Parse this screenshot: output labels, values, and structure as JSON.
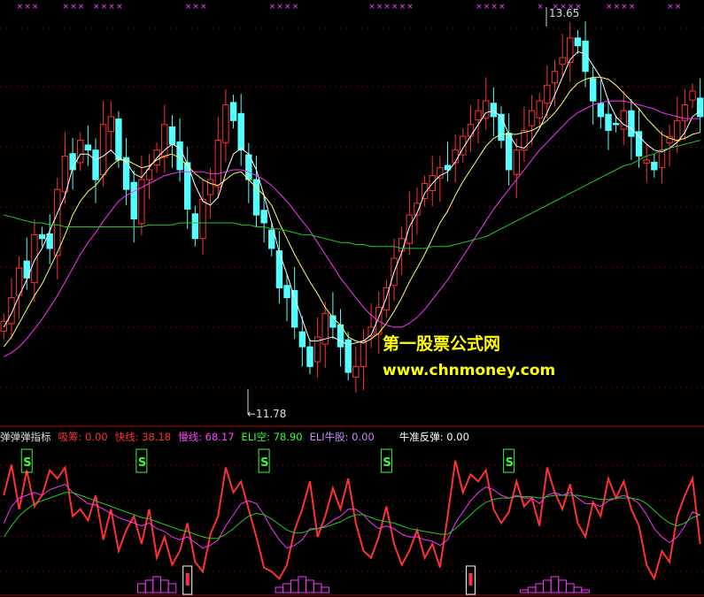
{
  "colors": {
    "up": "#ff3232",
    "down": "#54ffff",
    "ma5": "#ffffff",
    "ma10": "#ffff66",
    "ma20": "#ff33ff",
    "ma60": "#22cc22",
    "grid": "#7a0000",
    "axis": "#b00000",
    "watermark": "#ffff00",
    "signal": "#33ff33",
    "cross": "#ff44ff"
  },
  "watermark": {
    "line1": "第一股票公式网",
    "line2": "www.chnmoney.com"
  },
  "price_panel": {
    "high_label": "13.65",
    "low_label": "←11.78"
  },
  "indicator_panel": {
    "title": "弹弹弹指标",
    "items": [
      {
        "text": "吸筹: 0.00",
        "color": "#ff3333"
      },
      {
        "text": "快线: 38.18",
        "color": "#ff3333"
      },
      {
        "text": "慢线: 68.17",
        "color": "#ff44ff"
      },
      {
        "text": "ELI空: 78.90",
        "color": "#33ff33"
      },
      {
        "text": "ELI牛股: 0.00",
        "color": "#cc88ff"
      },
      {
        "text": "牛准反弹: 0.00",
        "color": "#ffffff"
      }
    ],
    "signal_label": "S"
  },
  "chart_data": [
    {
      "type": "candlestick",
      "title": "",
      "high_marker": 13.65,
      "low_marker": 11.78,
      "ylim": [
        11.7,
        13.75
      ],
      "grid": true,
      "series": [
        {
          "name": "close",
          "values": [
            12.18,
            12.3,
            12.45,
            12.4,
            12.62,
            12.6,
            12.55,
            12.85,
            13.02,
            12.95,
            13.1,
            13.05,
            12.9,
            13.18,
            13.22,
            13.0,
            12.85,
            12.7,
            12.9,
            12.95,
            13.05,
            13.18,
            13.08,
            12.95,
            12.75,
            12.6,
            12.8,
            12.9,
            13.1,
            13.28,
            13.2,
            13.05,
            12.9,
            12.72,
            12.68,
            12.55,
            12.35,
            12.3,
            12.15,
            12.05,
            11.95,
            12.1,
            12.22,
            12.15,
            12.05,
            11.92,
            11.95,
            12.08,
            12.15,
            12.25,
            12.35,
            12.5,
            12.6,
            12.72,
            12.78,
            12.88,
            12.92,
            12.96,
            12.95,
            13.05,
            13.12,
            13.18,
            13.25,
            13.3,
            13.22,
            13.1,
            12.95,
            13.05,
            13.15,
            13.25,
            13.3,
            13.38,
            13.45,
            13.52,
            13.62,
            13.58,
            13.45,
            13.3,
            13.22,
            13.15,
            13.18,
            13.25,
            13.12,
            13.02,
            13.0,
            12.95,
            13.05,
            13.12,
            13.2,
            13.28,
            13.35,
            13.22
          ]
        },
        {
          "name": "MA5",
          "values": [
            12.15,
            12.22,
            12.31,
            12.39,
            12.49,
            12.55,
            12.64,
            12.73,
            12.82,
            12.96,
            13.03,
            13.03,
            13.0,
            13.02,
            13.05,
            13.01,
            12.99,
            12.93,
            12.91,
            12.96,
            13.01,
            13.05,
            13.08,
            13.06,
            12.98,
            12.87,
            12.79,
            12.77,
            12.81,
            12.93,
            13.03,
            13.06,
            13.03,
            12.95,
            12.82,
            12.68,
            12.53,
            12.42,
            12.3,
            12.19,
            12.08,
            12.08,
            12.09,
            12.1,
            12.08,
            12.06,
            12.07,
            12.08,
            12.11,
            12.2,
            12.3,
            12.43,
            12.53,
            12.66,
            12.73,
            12.83,
            12.88,
            12.92,
            12.94,
            12.99,
            13.06,
            13.12,
            13.18,
            13.24,
            13.25,
            13.22,
            13.13,
            13.07,
            13.06,
            13.1,
            13.16,
            13.24,
            13.33,
            13.42,
            13.51,
            13.55,
            13.54,
            13.48,
            13.42,
            13.3,
            13.22,
            13.18,
            13.16,
            13.12,
            13.08,
            13.05,
            13.04,
            13.06,
            13.09,
            13.14,
            13.22,
            13.25
          ]
        },
        {
          "name": "MA10",
          "values": [
            12.05,
            12.1,
            12.17,
            12.24,
            12.31,
            12.37,
            12.45,
            12.53,
            12.62,
            12.72,
            12.79,
            12.84,
            12.87,
            12.92,
            12.97,
            13.0,
            13.0,
            12.98,
            12.96,
            12.97,
            13.0,
            13.02,
            13.03,
            13.01,
            12.97,
            12.93,
            12.9,
            12.88,
            12.87,
            12.9,
            12.93,
            12.94,
            12.9,
            12.86,
            12.82,
            12.77,
            12.68,
            12.6,
            12.52,
            12.45,
            12.38,
            12.32,
            12.25,
            12.2,
            12.16,
            12.1,
            12.08,
            12.07,
            12.09,
            12.12,
            12.17,
            12.23,
            12.3,
            12.38,
            12.45,
            12.52,
            12.6,
            12.68,
            12.74,
            12.82,
            12.89,
            12.95,
            13.01,
            13.07,
            13.11,
            13.13,
            13.13,
            13.13,
            13.14,
            13.15,
            13.17,
            13.2,
            13.24,
            13.29,
            13.35,
            13.39,
            13.41,
            13.42,
            13.42,
            13.41,
            13.38,
            13.34,
            13.3,
            13.26,
            13.21,
            13.17,
            13.13,
            13.11,
            13.1,
            13.11,
            13.13,
            13.14
          ]
        },
        {
          "name": "MA20",
          "values": [
            12.0,
            12.02,
            12.05,
            12.09,
            12.14,
            12.19,
            12.25,
            12.31,
            12.38,
            12.45,
            12.52,
            12.58,
            12.63,
            12.69,
            12.74,
            12.79,
            12.82,
            12.84,
            12.86,
            12.88,
            12.9,
            12.92,
            12.93,
            12.94,
            12.94,
            12.94,
            12.94,
            12.93,
            12.93,
            12.94,
            12.95,
            12.95,
            12.94,
            12.92,
            12.9,
            12.87,
            12.83,
            12.79,
            12.74,
            12.69,
            12.64,
            12.58,
            12.52,
            12.46,
            12.4,
            12.35,
            12.3,
            12.25,
            12.21,
            12.18,
            12.16,
            12.15,
            12.15,
            12.17,
            12.2,
            12.24,
            12.29,
            12.34,
            12.39,
            12.45,
            12.51,
            12.57,
            12.63,
            12.69,
            12.75,
            12.8,
            12.85,
            12.9,
            12.95,
            13.0,
            13.05,
            13.09,
            13.13,
            13.17,
            13.21,
            13.24,
            13.26,
            13.28,
            13.29,
            13.3,
            13.3,
            13.3,
            13.29,
            13.28,
            13.27,
            13.26,
            13.24,
            13.23,
            13.22,
            13.21,
            13.21,
            13.21
          ]
        },
        {
          "name": "MA60",
          "values": [
            12.72,
            12.71,
            12.7,
            12.69,
            12.68,
            12.68,
            12.67,
            12.67,
            12.66,
            12.66,
            12.66,
            12.66,
            12.66,
            12.66,
            12.66,
            12.66,
            12.66,
            12.66,
            12.66,
            12.67,
            12.67,
            12.67,
            12.67,
            12.68,
            12.68,
            12.68,
            12.68,
            12.68,
            12.68,
            12.68,
            12.68,
            12.67,
            12.67,
            12.66,
            12.66,
            12.65,
            12.65,
            12.64,
            12.63,
            12.62,
            12.62,
            12.61,
            12.6,
            12.59,
            12.58,
            12.58,
            12.57,
            12.57,
            12.56,
            12.56,
            12.56,
            12.56,
            12.55,
            12.55,
            12.55,
            12.55,
            12.56,
            12.56,
            12.56,
            12.57,
            12.58,
            12.59,
            12.6,
            12.61,
            12.63,
            12.65,
            12.67,
            12.69,
            12.71,
            12.73,
            12.75,
            12.77,
            12.79,
            12.81,
            12.83,
            12.85,
            12.87,
            12.89,
            12.91,
            12.93,
            12.95,
            12.97,
            12.98,
            13.0,
            13.02,
            13.03,
            13.05,
            13.06,
            13.07,
            13.08,
            13.09,
            13.1
          ]
        }
      ]
    },
    {
      "type": "line",
      "title": "",
      "ylim": [
        0,
        105
      ],
      "series": [
        {
          "name": "快线",
          "values": [
            70,
            92,
            60,
            88,
            62,
            70,
            88,
            82,
            90,
            55,
            60,
            52,
            70,
            38,
            60,
            30,
            45,
            55,
            35,
            60,
            25,
            40,
            20,
            30,
            50,
            22,
            15,
            42,
            55,
            90,
            72,
            80,
            60,
            40,
            18,
            15,
            10,
            20,
            45,
            60,
            80,
            40,
            55,
            75,
            60,
            82,
            50,
            30,
            25,
            40,
            62,
            35,
            20,
            30,
            45,
            25,
            35,
            18,
            55,
            95,
            72,
            85,
            80,
            88,
            60,
            50,
            58,
            80,
            62,
            68,
            48,
            90,
            72,
            60,
            78,
            50,
            40,
            65,
            55,
            82,
            68,
            80,
            60,
            48,
            20,
            10,
            30,
            22,
            55,
            70,
            82,
            35
          ]
        },
        {
          "name": "慢线",
          "values": [
            50,
            62,
            68,
            70,
            72,
            70,
            74,
            76,
            78,
            72,
            68,
            64,
            63,
            60,
            57,
            54,
            52,
            50,
            48,
            50,
            46,
            44,
            40,
            38,
            40,
            36,
            32,
            34,
            38,
            48,
            56,
            64,
            66,
            64,
            56,
            46,
            38,
            32,
            34,
            38,
            46,
            46,
            48,
            52,
            55,
            60,
            60,
            56,
            50,
            46,
            48,
            46,
            42,
            40,
            40,
            38,
            37,
            34,
            38,
            50,
            58,
            66,
            72,
            76,
            74,
            70,
            68,
            70,
            68,
            68,
            64,
            70,
            72,
            70,
            72,
            68,
            64,
            64,
            62,
            66,
            68,
            70,
            68,
            64,
            56,
            46,
            40,
            36,
            40,
            48,
            58,
            56
          ]
        },
        {
          "name": "ELI空",
          "values": [
            40,
            48,
            55,
            60,
            64,
            66,
            68,
            70,
            72,
            72,
            70,
            68,
            66,
            64,
            62,
            60,
            58,
            56,
            54,
            53,
            51,
            49,
            47,
            45,
            44,
            42,
            40,
            39,
            39,
            42,
            46,
            51,
            55,
            57,
            56,
            53,
            49,
            45,
            43,
            43,
            45,
            46,
            47,
            49,
            51,
            54,
            56,
            56,
            54,
            52,
            51,
            50,
            48,
            46,
            45,
            44,
            43,
            42,
            42,
            46,
            51,
            56,
            61,
            65,
            67,
            68,
            68,
            69,
            69,
            69,
            68,
            69,
            70,
            70,
            70,
            70,
            69,
            68,
            67,
            67,
            68,
            68,
            68,
            67,
            64,
            59,
            54,
            50,
            48,
            50,
            54,
            56
          ]
        }
      ]
    }
  ]
}
